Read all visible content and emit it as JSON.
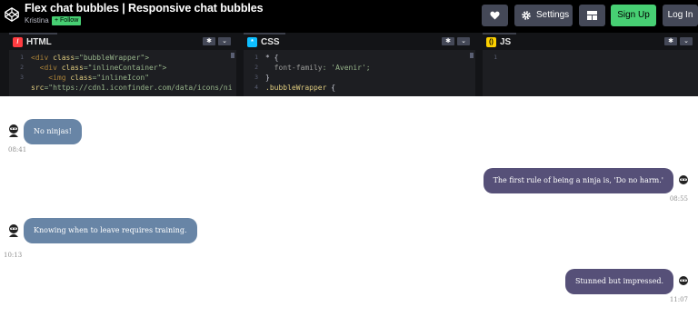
{
  "header": {
    "title": "Flex chat bubbles | Responsive chat bubbles",
    "author": "Kristina",
    "follow_label": "+ Follow",
    "buttons": {
      "heart_icon": "heart-icon",
      "settings_label": "Settings",
      "layout_icon": "layout-icon",
      "signup_label": "Sign Up",
      "login_label": "Log In"
    },
    "colors": {
      "bar": "#000000",
      "button": "#444857",
      "accent": "#47cf73"
    }
  },
  "editors": {
    "html": {
      "label": "HTML",
      "lines": [
        {
          "num": "1",
          "parts": [
            {
              "t": "<div ",
              "c": "tag"
            },
            {
              "t": "class",
              "c": "attr"
            },
            {
              "t": "=\"bubbleWrapper\">",
              "c": "str"
            }
          ]
        },
        {
          "num": "2",
          "parts": [
            {
              "t": "  <div ",
              "c": "tag"
            },
            {
              "t": "class",
              "c": "attr"
            },
            {
              "t": "=\"inlineContainer\">",
              "c": "str"
            }
          ]
        },
        {
          "num": "3",
          "parts": [
            {
              "t": "    <img ",
              "c": "tag"
            },
            {
              "t": "class",
              "c": "attr"
            },
            {
              "t": "=\"inlineIcon\"",
              "c": "str"
            }
          ]
        },
        {
          "num": "",
          "parts": [
            {
              "t": "src",
              "c": "attr"
            },
            {
              "t": "=\"https://cdn1.iconfinder.com/data/icons/ni",
              "c": "str"
            }
          ]
        }
      ]
    },
    "css": {
      "label": "CSS",
      "lines": [
        {
          "num": "1",
          "parts": [
            {
              "t": "* {",
              "c": "plain"
            }
          ]
        },
        {
          "num": "2",
          "parts": [
            {
              "t": "  font-family",
              "c": "prop"
            },
            {
              "t": ": 'Avenir';",
              "c": "str"
            }
          ]
        },
        {
          "num": "3",
          "parts": [
            {
              "t": "}",
              "c": "plain"
            }
          ]
        },
        {
          "num": "4",
          "parts": [
            {
              "t": ".bubbleWrapper",
              "c": "sel"
            },
            {
              "t": " {",
              "c": "plain"
            }
          ]
        }
      ]
    },
    "js": {
      "label": "JS",
      "lines": [
        {
          "num": "1",
          "parts": []
        }
      ]
    }
  },
  "chat": {
    "messages": [
      {
        "side": "left",
        "text": "No ninjas!",
        "time": "08:41"
      },
      {
        "side": "right",
        "text": "The first rule of being a ninja is, 'Do no harm.'",
        "time": "08:55"
      },
      {
        "side": "left",
        "text": "Knowing when to leave requires training.",
        "time": "10:13"
      },
      {
        "side": "right",
        "text": "Stunned but impressed.",
        "time": "11:07"
      }
    ],
    "avatar_icon": "ninja-icon",
    "colors": {
      "left_bubble": "#6885a6",
      "right_bubble": "#565078"
    }
  }
}
